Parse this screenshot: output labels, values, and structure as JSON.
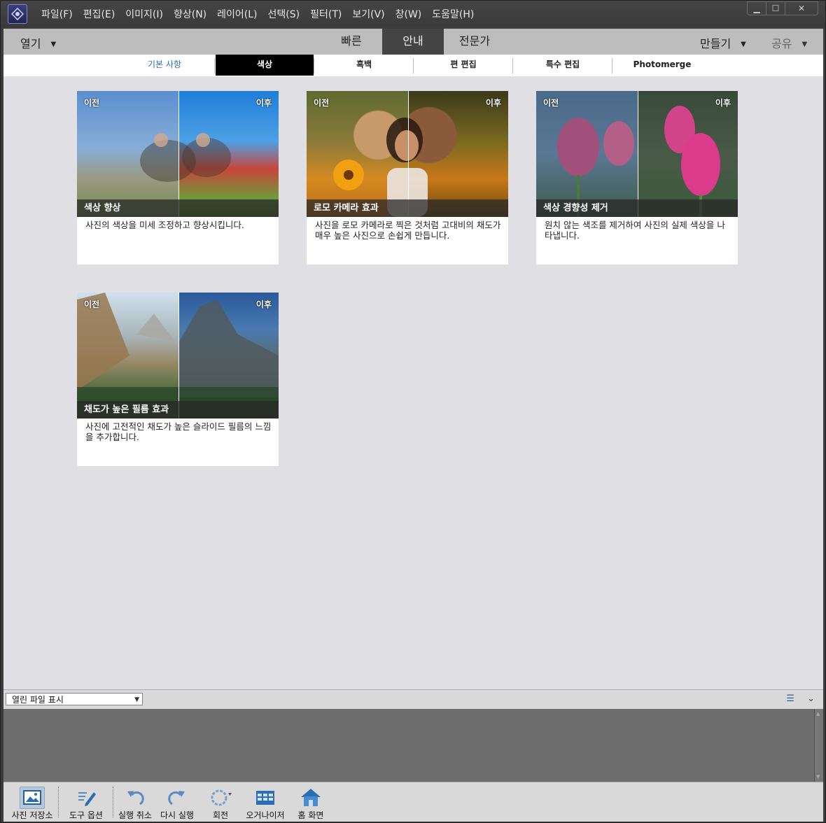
{
  "menu": [
    "파일(F)",
    "편집(E)",
    "이미지(I)",
    "향상(N)",
    "레이어(L)",
    "선택(S)",
    "필터(T)",
    "보기(V)",
    "창(W)",
    "도움말(H)"
  ],
  "modebar": {
    "open_label": "열기",
    "tabs": [
      {
        "label": "빠른",
        "active": false
      },
      {
        "label": "안내",
        "active": true
      },
      {
        "label": "전문가",
        "active": false
      }
    ],
    "create_label": "만들기",
    "share_label": "공유"
  },
  "subtabs": [
    {
      "label": "기본 사항",
      "active": false
    },
    {
      "label": "색상",
      "active": true
    },
    {
      "label": "흑백",
      "active": false
    },
    {
      "label": "편 편집",
      "active": false
    },
    {
      "label": "특수 편집",
      "active": false
    },
    {
      "label": "Photomerge",
      "active": false
    }
  ],
  "cards": [
    {
      "before": "이전",
      "after": "이후",
      "title": "색상 향상",
      "description": "사진의 색상을 미세 조정하고 향상시킵니다."
    },
    {
      "before": "이전",
      "after": "이후",
      "title": "로모 카메라 효과",
      "description": "사진을 로모 카메라로 찍은 것처럼 고대비의 채도가 매우 높은 사진으로 손쉽게 만듭니다."
    },
    {
      "before": "이전",
      "after": "이후",
      "title": "색상 경향성 제거",
      "description": "원치 않는 색조를 제거하여 사진의 실제 색상을 나타냅니다."
    },
    {
      "before": "이전",
      "after": "이후",
      "title": "채도가 높은 필름 효과",
      "description": "사진에 고전적인 채도가 높은 슬라이드 필름의 느낌을 추가합니다."
    }
  ],
  "bin": {
    "select_value": "열린 파일 표시"
  },
  "toolbar": [
    {
      "label": "사진 저장소",
      "icon": "photo-bin-icon",
      "selected": true
    },
    {
      "label": "도구 옵션",
      "icon": "tool-options-icon",
      "selected": false
    },
    {
      "label": "실행 취소",
      "icon": "undo-icon",
      "selected": false
    },
    {
      "label": "다시 실행",
      "icon": "redo-icon",
      "selected": false
    },
    {
      "label": "회전",
      "icon": "rotate-icon",
      "selected": false
    },
    {
      "label": "오거나이저",
      "icon": "organizer-icon",
      "selected": false
    },
    {
      "label": "홈 화면",
      "icon": "home-icon",
      "selected": false
    }
  ],
  "colors": {
    "accent_blue": "#2a6fb2",
    "active_tab": "#444444",
    "content_bg": "#e0e0e4"
  }
}
